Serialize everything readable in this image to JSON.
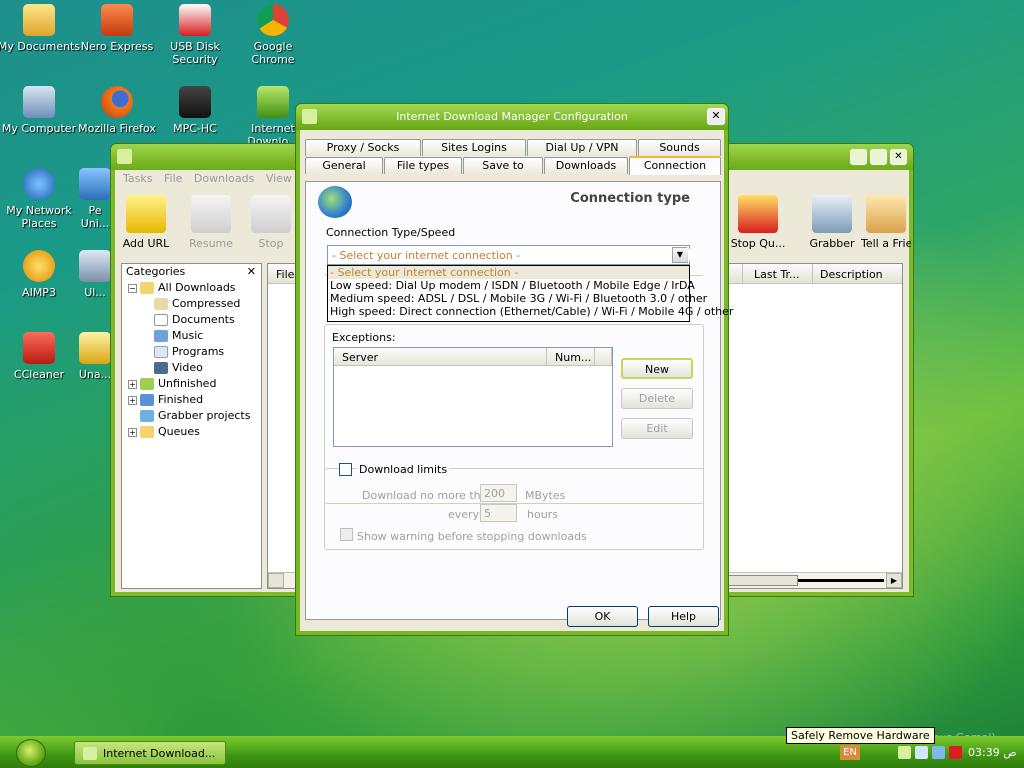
{
  "desktop_icons": [
    {
      "label": "My Documents"
    },
    {
      "label": "Nero Express"
    },
    {
      "label": "USB Disk Security"
    },
    {
      "label": "Google Chrome"
    },
    {
      "label": "My Computer"
    },
    {
      "label": "Mozilla Firefox"
    },
    {
      "label": "MPC-HC"
    },
    {
      "label": "Internet Downlo..."
    },
    {
      "label": "My Network Places"
    },
    {
      "label": "Pe Uni..."
    },
    {
      "label": "AIMP3"
    },
    {
      "label": "Ul..."
    },
    {
      "label": "CCleaner"
    },
    {
      "label": "Una..."
    }
  ],
  "main_window": {
    "menu": [
      "Tasks",
      "File",
      "Downloads",
      "View"
    ],
    "toolbar": {
      "add_url": "Add URL",
      "resume": "Resume",
      "stop": "Stop",
      "stop_queue": "Stop Qu...",
      "grabber": "Grabber",
      "tell_friend": "Tell a Frie..."
    },
    "categories": {
      "header": "Categories",
      "close": "✕",
      "items": [
        "All Downloads",
        "Compressed",
        "Documents",
        "Music",
        "Programs",
        "Video",
        "Unfinished",
        "Finished",
        "Grabber projects",
        "Queues"
      ]
    },
    "list_columns": {
      "file": "File",
      "last_try": "Last Tr...",
      "description": "Description"
    }
  },
  "dialog": {
    "title": "Internet Download Manager Configuration",
    "tabs_back": [
      "Proxy / Socks",
      "Sites Logins",
      "Dial Up / VPN",
      "Sounds"
    ],
    "tabs_front": [
      "General",
      "File types",
      "Save to",
      "Downloads",
      "Connection"
    ],
    "section_title": "Connection type",
    "conn_type_label": "Connection Type/Speed",
    "combo_value": "- Select your internet connection -",
    "options": [
      "- Select your internet connection -",
      "Low speed: Dial Up modem / ISDN / Bluetooth / Mobile Edge / IrDA",
      "Medium speed: ADSL / DSL /  Mobile 3G / Wi-Fi / Bluetooth 3.0 / other",
      "High speed: Direct connection (Ethernet/Cable) / Wi-Fi / Mobile 4G / other"
    ],
    "exceptions_label": "Exceptions:",
    "table_headers": {
      "server": "Server",
      "num": "Num..."
    },
    "buttons": {
      "new": "New",
      "delete": "Delete",
      "edit": "Edit",
      "ok": "OK",
      "help": "Help"
    },
    "download_limits": {
      "label": "Download limits",
      "no_more_than": "Download no more than",
      "mb_value": "200",
      "mb_unit": "MBytes",
      "every": "every",
      "hours_value": "5",
      "hours_unit": "hours",
      "warning": "Show warning before stopping downloads"
    }
  },
  "taskbar": {
    "item": "Internet Download...",
    "tooltip": "Safely Remove Hardware",
    "lang": "EN",
    "clock": "03:39 ص",
    "bg_text": "mous Gamal)"
  }
}
